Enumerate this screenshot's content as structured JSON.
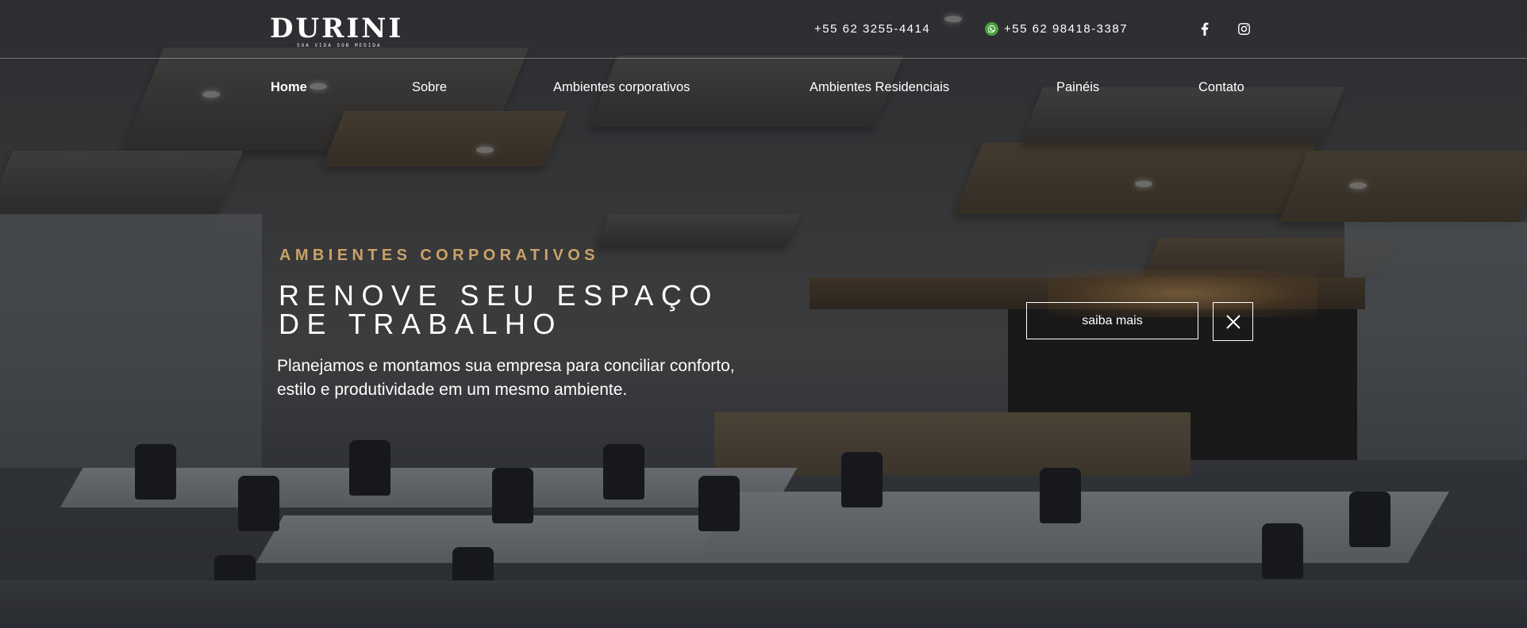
{
  "brand": {
    "name": "DURINI",
    "tagline": "SUA VIDA SOB MEDIDA"
  },
  "contacts": {
    "phone_1": "+55 62 3255-4414",
    "phone_2": "+55 62 98418-3387",
    "whatsapp_icon": "whatsapp-icon",
    "whatsapp_color": "#4aa23a"
  },
  "social": {
    "facebook_icon": "facebook-icon",
    "instagram_icon": "instagram-icon"
  },
  "nav": {
    "items": [
      {
        "label": "Home",
        "active": true
      },
      {
        "label": "Sobre",
        "active": false
      },
      {
        "label": "Ambientes corporativos",
        "active": false
      },
      {
        "label": "Ambientes Residenciais",
        "active": false
      },
      {
        "label": "Painéis",
        "active": false
      },
      {
        "label": "Contato",
        "active": false
      }
    ]
  },
  "hero": {
    "eyebrow": "AMBIENTES CORPORATIVOS",
    "headline_line1": "RENOVE SEU ESPAÇO",
    "headline_line2": "DE TRABALHO",
    "description_line1": "Planejamos e montamos sua empresa para conciliar conforto,",
    "description_line2": "estilo e produtividade em um mesmo ambiente.",
    "cta_label": "saiba mais",
    "close_icon": "close-icon",
    "accent_color": "#c9a368"
  }
}
